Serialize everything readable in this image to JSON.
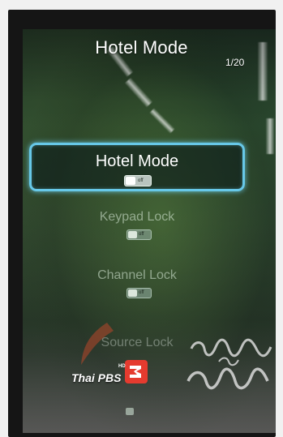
{
  "screen": {
    "title": "Hotel Mode",
    "page_counter": "1/20"
  },
  "menu": {
    "items": [
      {
        "label": "Hotel Mode",
        "toggle_state": "off",
        "focused": true
      },
      {
        "label": "Keypad Lock",
        "toggle_state": "off",
        "focused": false
      },
      {
        "label": "Channel Lock",
        "toggle_state": "off",
        "focused": false
      },
      {
        "label": "Source Lock",
        "toggle_state": "off",
        "focused": false
      }
    ]
  },
  "broadcast": {
    "channel_name": "Thai PBS",
    "logo_badge": "HD",
    "logo_number": "3"
  },
  "colors": {
    "focus_ring": "#67c8e8",
    "title_text": "#ffffff",
    "inactive_text": "#daecda",
    "logo_red": "#e53b2f"
  }
}
